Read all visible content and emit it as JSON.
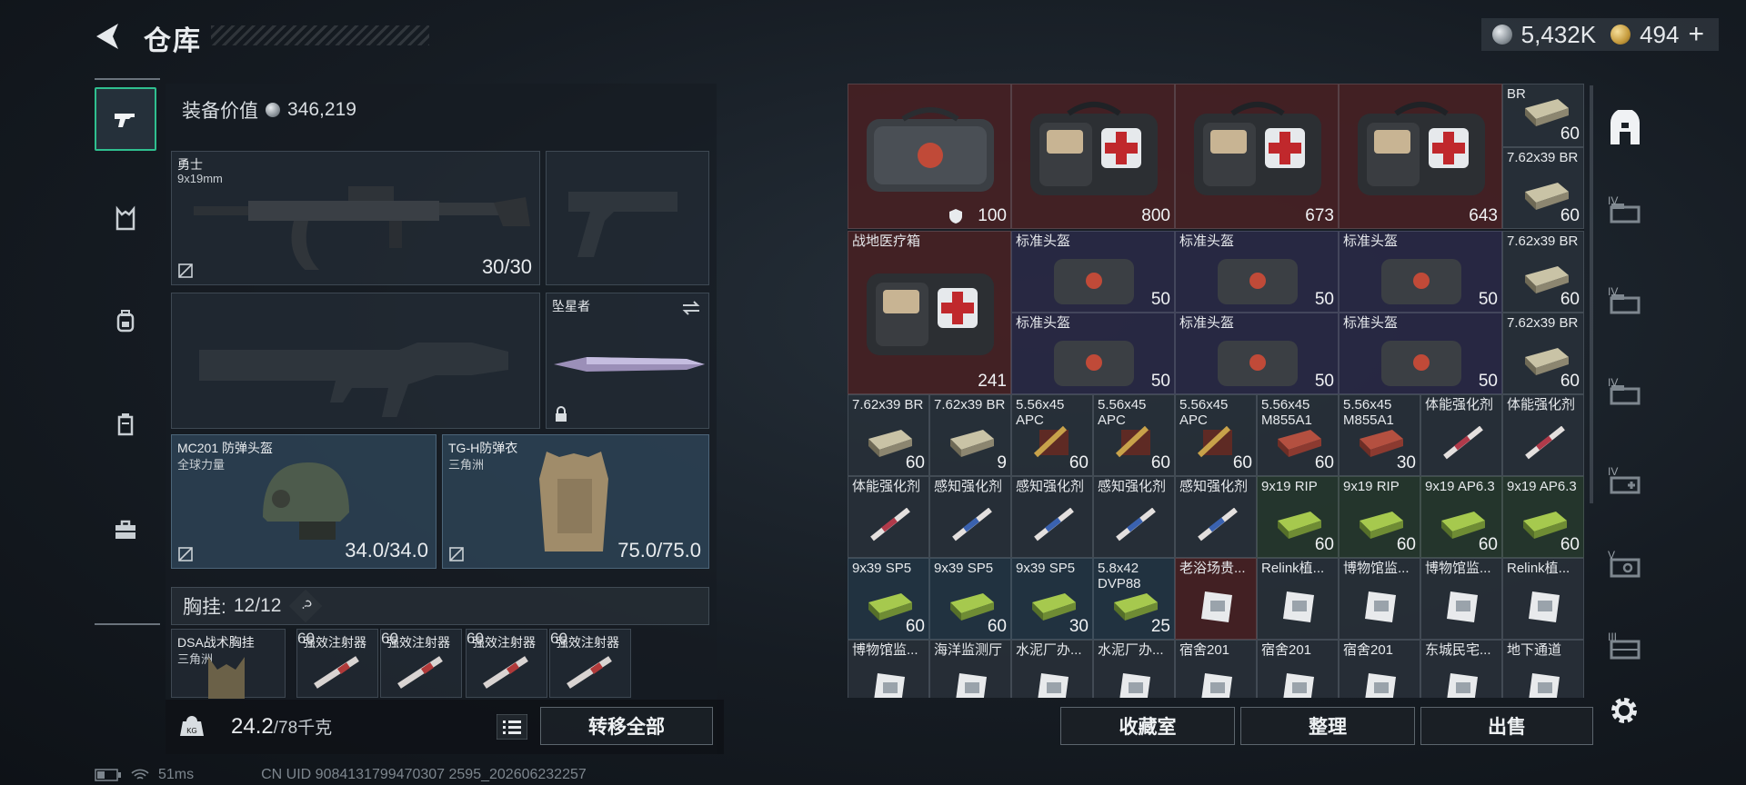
{
  "header": {
    "title": "仓库"
  },
  "currency": {
    "silver": "5,432K",
    "gold": "494",
    "add": "+"
  },
  "equipment": {
    "value_label": "装备价值",
    "value": "346,219",
    "primary": {
      "name": "勇士",
      "sub": "9x19mm",
      "ammo": "30/30"
    },
    "melee": {
      "name": "坠星者"
    },
    "helmet": {
      "name": "MC201 防弹头盔",
      "sub": "全球力量",
      "dur": "34.0/34.0"
    },
    "armor": {
      "name": "TG-H防弹衣",
      "sub": "三角洲",
      "dur": "75.0/75.0"
    },
    "chest_label": "胸挂:",
    "chest_count": "12/12",
    "chest_help": "?",
    "chest_rig": {
      "name": "DSA战术胸挂",
      "sub": "三角洲"
    },
    "injectors": [
      {
        "name": "强效注射器",
        "val": "60"
      },
      {
        "name": "强效注射器",
        "val": "60"
      },
      {
        "name": "强效注射器",
        "val": "60"
      },
      {
        "name": "强效注射器",
        "val": "60"
      }
    ]
  },
  "weight": {
    "current": "24.2",
    "max": "/78千克",
    "transfer_label": "转移全部"
  },
  "status": {
    "ping": "51ms",
    "uid": "CN UID 9084131799470307 2595_202606232257"
  },
  "grid_row1": [
    {
      "name": "",
      "val": "100"
    },
    {
      "name": "",
      "val": "800"
    },
    {
      "name": "",
      "val": "673"
    },
    {
      "name": "",
      "val": "643"
    },
    {
      "name": "BR",
      "val": "60"
    }
  ],
  "grid_row1b": [
    {
      "name": "7.62x39 BR",
      "val": "60"
    }
  ],
  "field_kit": {
    "name": "战地医疗箱",
    "val": "241"
  },
  "helmets": [
    {
      "name": "标准头盔",
      "val": "50"
    },
    {
      "name": "标准头盔",
      "val": "50"
    },
    {
      "name": "标准头盔",
      "val": "50"
    },
    {
      "name": "标准头盔",
      "val": "50"
    },
    {
      "name": "标准头盔",
      "val": "50"
    },
    {
      "name": "标准头盔",
      "val": "50"
    }
  ],
  "side_ammo": [
    {
      "name": "7.62x39 BR",
      "val": "60"
    },
    {
      "name": "7.62x39 BR",
      "val": "60"
    }
  ],
  "row4": [
    {
      "name": "7.62x39 BR",
      "val": "60"
    },
    {
      "name": "7.62x39 BR",
      "val": "9"
    },
    {
      "name": "5.56x45 APC",
      "val": "60"
    },
    {
      "name": "5.56x45 APC",
      "val": "60"
    },
    {
      "name": "5.56x45 APC",
      "val": "60"
    },
    {
      "name": "5.56x45 M855A1",
      "val": "60"
    },
    {
      "name": "5.56x45 M855A1",
      "val": "30"
    },
    {
      "name": "体能强化剂",
      "val": ""
    },
    {
      "name": "体能强化剂",
      "val": ""
    }
  ],
  "row5": [
    {
      "name": "体能强化剂",
      "val": ""
    },
    {
      "name": "感知强化剂",
      "val": ""
    },
    {
      "name": "感知强化剂",
      "val": ""
    },
    {
      "name": "感知强化剂",
      "val": ""
    },
    {
      "name": "感知强化剂",
      "val": ""
    },
    {
      "name": "9x19 RIP",
      "val": "60"
    },
    {
      "name": "9x19 RIP",
      "val": "60"
    },
    {
      "name": "9x19 AP6.3",
      "val": "60"
    },
    {
      "name": "9x19 AP6.3",
      "val": "60"
    }
  ],
  "row6": [
    {
      "name": "9x39 SP5",
      "val": "60"
    },
    {
      "name": "9x39 SP5",
      "val": "60"
    },
    {
      "name": "9x39 SP5",
      "val": "30"
    },
    {
      "name": "5.8x42 DVP88",
      "val": "25"
    },
    {
      "name": "老浴场贵...",
      "val": ""
    },
    {
      "name": "Relink植...",
      "val": ""
    },
    {
      "name": "博物馆监...",
      "val": ""
    },
    {
      "name": "博物馆监...",
      "val": ""
    },
    {
      "name": "Relink植...",
      "val": ""
    }
  ],
  "row7": [
    {
      "name": "博物馆监...",
      "val": ""
    },
    {
      "name": "海洋监测厅",
      "val": ""
    },
    {
      "name": "水泥厂办...",
      "val": ""
    },
    {
      "name": "水泥厂办...",
      "val": ""
    },
    {
      "name": "宿舍201",
      "val": ""
    },
    {
      "name": "宿舍201",
      "val": ""
    },
    {
      "name": "宿舍201",
      "val": ""
    },
    {
      "name": "东城民宅...",
      "val": ""
    },
    {
      "name": "地下通道",
      "val": ""
    }
  ],
  "bottom_buttons": {
    "collection": "收藏室",
    "sort": "整理",
    "sell": "出售"
  },
  "right_tabs": [
    "IV",
    "IV",
    "IV",
    "IV",
    "V",
    "III"
  ],
  "colors": {
    "accent": "#2fbf8f"
  }
}
